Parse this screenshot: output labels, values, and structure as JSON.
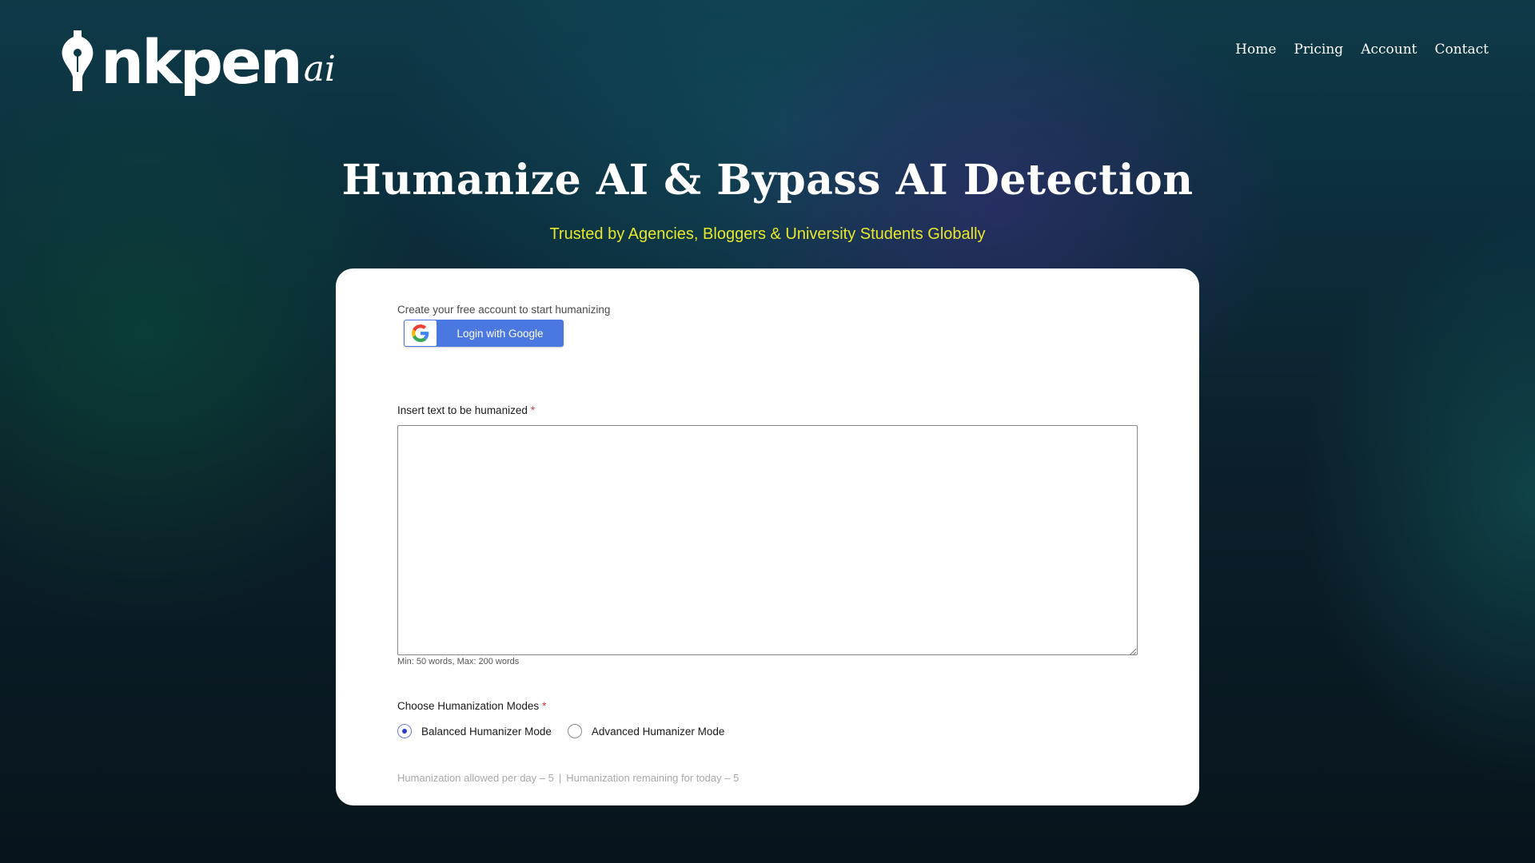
{
  "header": {
    "logo": {
      "word": "nkpen",
      "suffix": "ai"
    },
    "nav": [
      {
        "label": "Home"
      },
      {
        "label": "Pricing"
      },
      {
        "label": "Account"
      },
      {
        "label": "Contact"
      }
    ]
  },
  "hero": {
    "title": "Humanize AI & Bypass AI Detection",
    "subtitle": "Trusted by Agencies, Bloggers & University Students Globally"
  },
  "form": {
    "create_account_text": "Create your free account to start humanizing",
    "google_button_label": "Login with Google",
    "text_field": {
      "label": "Insert text to be humanized",
      "required_marker": "*",
      "value": "",
      "placeholder": "",
      "hint": "Min: 50 words, Max: 200 words"
    },
    "modes": {
      "label": "Choose Humanization Modes",
      "required_marker": "*",
      "options": [
        {
          "label": "Balanced Humanizer Mode",
          "selected": true
        },
        {
          "label": "Advanced Humanizer Mode",
          "selected": false
        }
      ]
    },
    "usage": {
      "allowed": "Humanization allowed per day – 5",
      "separator": "|",
      "remaining": "Humanization remaining for today – 5"
    }
  },
  "colors": {
    "subtitle": "#e8e82a",
    "google_button": "#4a78e0",
    "radio_selected": "#2b3fc4",
    "required": "#d23b3b"
  },
  "icons": {
    "logo_pen": "fountain-pen-nib-icon",
    "google": "google-g-icon"
  }
}
